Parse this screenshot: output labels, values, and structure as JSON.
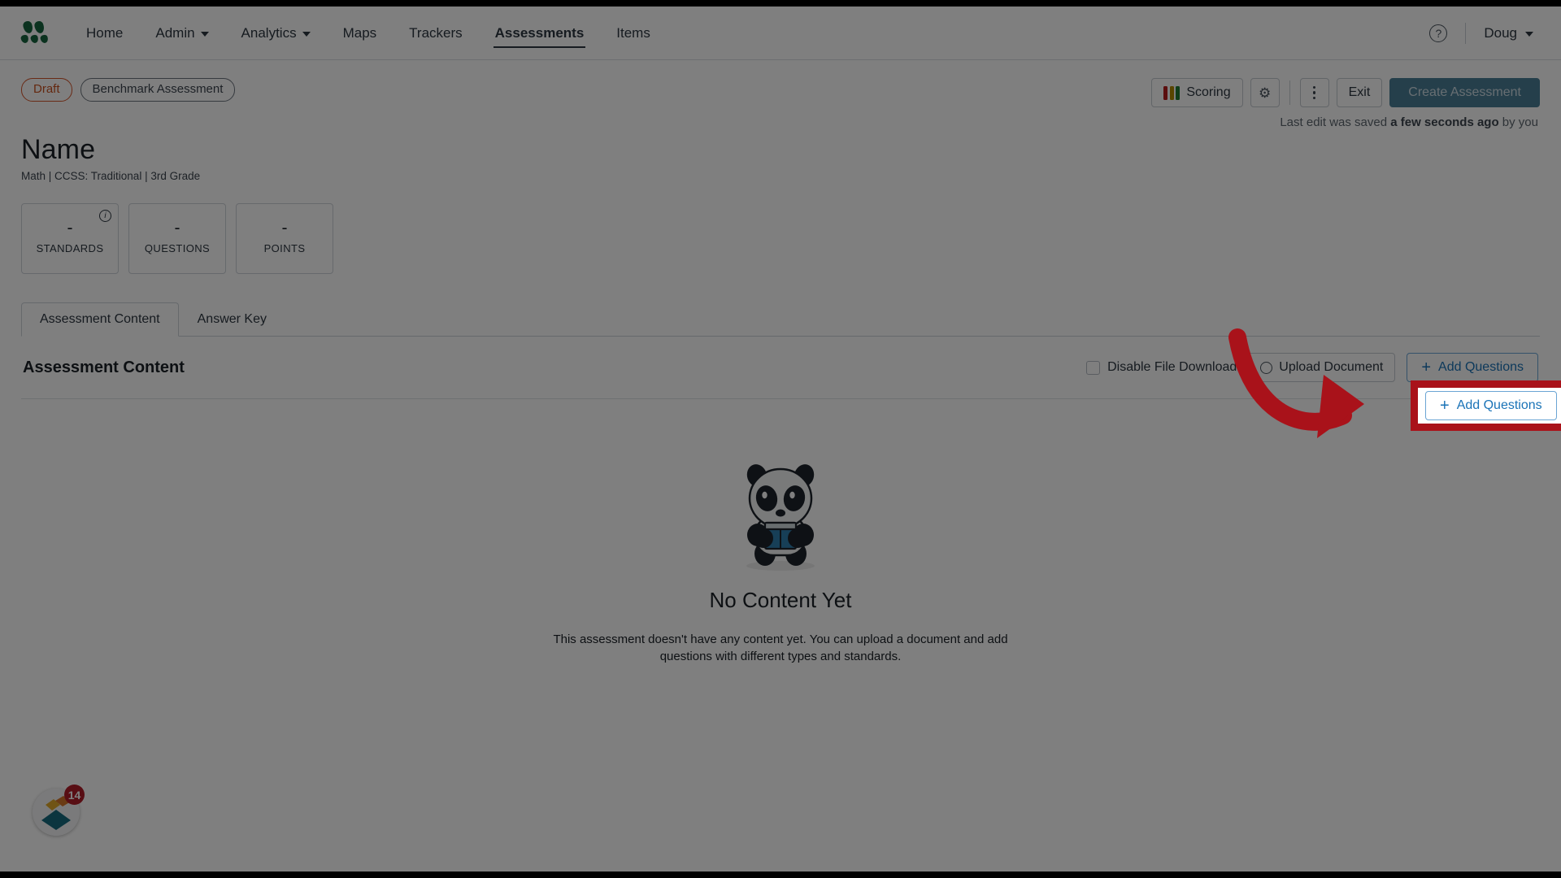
{
  "nav": {
    "logo_icon": "five-leaf-logo",
    "items": [
      {
        "label": "Home",
        "has_caret": false,
        "active": false
      },
      {
        "label": "Admin",
        "has_caret": true,
        "active": false
      },
      {
        "label": "Analytics",
        "has_caret": true,
        "active": false
      },
      {
        "label": "Maps",
        "has_caret": false,
        "active": false
      },
      {
        "label": "Trackers",
        "has_caret": false,
        "active": false
      },
      {
        "label": "Assessments",
        "has_caret": false,
        "active": true
      },
      {
        "label": "Items",
        "has_caret": false,
        "active": false
      }
    ],
    "help_icon": "question-mark-icon",
    "user_name": "Doug",
    "user_caret_icon": "chevron-down-icon"
  },
  "status": {
    "draft_label": "Draft",
    "type_label": "Benchmark Assessment"
  },
  "toolbar": {
    "scoring_label": "Scoring",
    "scoring_colors": [
      "#b71c1c",
      "#b08b00",
      "#1e7b32"
    ],
    "settings_icon": "gear-icon",
    "more_icon": "kebab-menu-icon",
    "exit_label": "Exit",
    "create_label": "Create Assessment",
    "create_color": "#4a7e96"
  },
  "saved_note": {
    "prefix": "Last edit was saved ",
    "strong": "a few seconds ago",
    "suffix": " by you"
  },
  "header": {
    "title": "Name",
    "subtitle": "Math  |  CCSS: Traditional  |  3rd Grade"
  },
  "stats": [
    {
      "value": "-",
      "label": "STANDARDS",
      "info_icon": "info-icon",
      "has_info": true
    },
    {
      "value": "-",
      "label": "QUESTIONS",
      "info_icon": "",
      "has_info": false
    },
    {
      "value": "-",
      "label": "POINTS",
      "info_icon": "",
      "has_info": false
    }
  ],
  "tabs": [
    {
      "label": "Assessment Content",
      "active": true
    },
    {
      "label": "Answer Key",
      "active": false
    }
  ],
  "content": {
    "title": "Assessment Content",
    "disable_download_label": "Disable File Download",
    "disable_download_checked": false,
    "upload_label": "Upload Document",
    "upload_icon": "upload-circle-icon",
    "add_questions_label": "Add Questions",
    "add_questions_icon": "plus-icon",
    "add_questions_color": "#1a73b7"
  },
  "empty_state": {
    "illustration": "panda-with-book-icon",
    "title": "No Content Yet",
    "description": "This assessment doesn't have any content yet. You can upload a document and add questions with different types and standards."
  },
  "fab": {
    "icon": "diamond-logo-icon",
    "badge_count": "14",
    "badge_color": "#b01c29"
  },
  "annotation": {
    "highlight_target": "add-questions-button",
    "arrow_icon": "curved-arrow-right-icon",
    "color": "#a9121a"
  }
}
